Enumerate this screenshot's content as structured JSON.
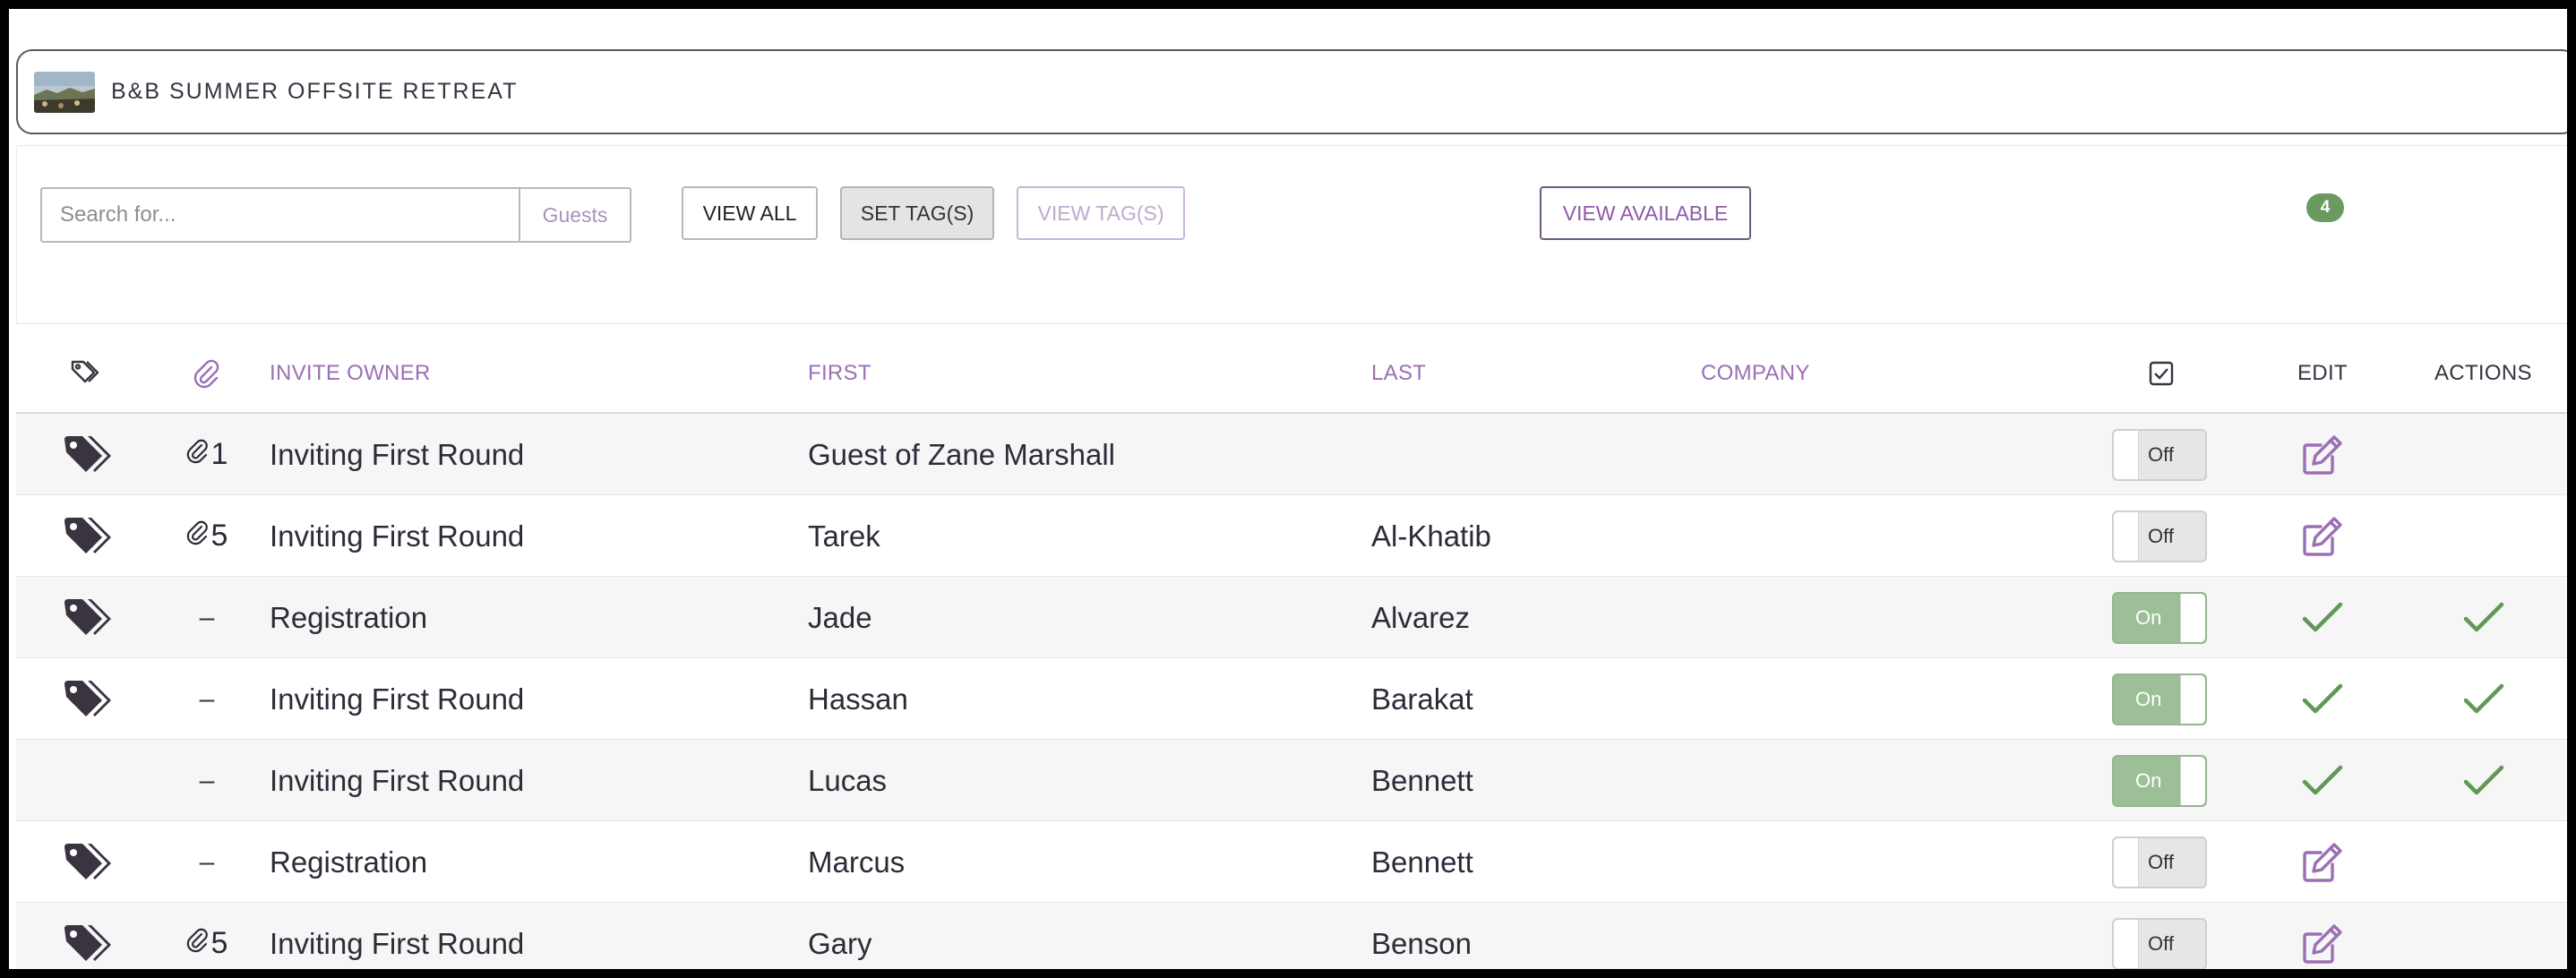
{
  "event": {
    "title": "B&B SUMMER OFFSITE RETREAT",
    "thumbnail_icon": "landscape-photo"
  },
  "toolbar": {
    "search_placeholder": "Search for...",
    "search_scope": "Guests",
    "view_all_label": "VIEW ALL",
    "set_tags_label": "SET TAG(S)",
    "view_tags_label": "VIEW TAG(S)",
    "view_available_label": "VIEW AVAILABLE",
    "count_badge": "4"
  },
  "table": {
    "headers": {
      "tag_icon": "tag-outline-icon",
      "attachment_icon": "paperclip-icon",
      "invite_owner": "INVITE OWNER",
      "first": "FIRST",
      "last": "LAST",
      "company": "COMPANY",
      "select_icon": "checkbox-checked-icon",
      "edit": "EDIT",
      "actions": "ACTIONS"
    },
    "rows": [
      {
        "tagged": true,
        "attachments": "1",
        "invite_owner": "Inviting First Round",
        "first": "Guest of Zane Marshall",
        "last": "",
        "company": "",
        "toggle": "Off",
        "edit": "edit-icon",
        "action": ""
      },
      {
        "tagged": true,
        "attachments": "5",
        "invite_owner": "Inviting First Round",
        "first": "Tarek",
        "last": "Al-Khatib",
        "company": "",
        "toggle": "Off",
        "edit": "edit-icon",
        "action": ""
      },
      {
        "tagged": true,
        "attachments": "–",
        "invite_owner": "Registration",
        "first": "Jade",
        "last": "Alvarez",
        "company": "",
        "toggle": "On",
        "edit": "check-icon",
        "action": "check-icon"
      },
      {
        "tagged": true,
        "attachments": "–",
        "invite_owner": "Inviting First Round",
        "first": "Hassan",
        "last": "Barakat",
        "company": "",
        "toggle": "On",
        "edit": "check-icon",
        "action": "check-icon"
      },
      {
        "tagged": false,
        "attachments": "–",
        "invite_owner": "Inviting First Round",
        "first": "Lucas",
        "last": "Bennett",
        "company": "",
        "toggle": "On",
        "edit": "check-icon",
        "action": "check-icon"
      },
      {
        "tagged": true,
        "attachments": "–",
        "invite_owner": "Registration",
        "first": "Marcus",
        "last": "Bennett",
        "company": "",
        "toggle": "Off",
        "edit": "edit-icon",
        "action": ""
      },
      {
        "tagged": true,
        "attachments": "5",
        "invite_owner": "Inviting First Round",
        "first": "Gary",
        "last": "Benson",
        "company": "",
        "toggle": "Off",
        "edit": "edit-icon",
        "action": ""
      }
    ]
  },
  "colors": {
    "accent_purple": "#9b6fb5",
    "on_green": "#9dbf98",
    "check_green": "#5f9a55",
    "badge_green": "#6a9a5f",
    "tag_dark": "#3a3340"
  }
}
